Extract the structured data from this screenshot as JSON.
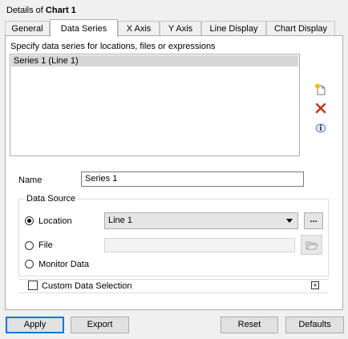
{
  "window": {
    "title_prefix": "Details of ",
    "title_subject": "Chart 1"
  },
  "tabs": [
    {
      "label": "General",
      "active": false
    },
    {
      "label": "Data Series",
      "active": true
    },
    {
      "label": "X Axis",
      "active": false
    },
    {
      "label": "Y Axis",
      "active": false
    },
    {
      "label": "Line Display",
      "active": false
    },
    {
      "label": "Chart Display",
      "active": false
    }
  ],
  "series_list": {
    "hint": "Specify data series for locations, files or expressions",
    "items": [
      "Series 1 (Line 1)"
    ],
    "selected_index": 0,
    "icons": [
      "new-series-icon",
      "delete-icon",
      "info-icon"
    ]
  },
  "name_field": {
    "label": "Name",
    "value": "Series 1"
  },
  "data_source": {
    "legend": "Data Source",
    "location_label": "Location",
    "location_value": "Line 1",
    "browse_dots": "...",
    "file_label": "File",
    "file_value": "",
    "monitor_label": "Monitor Data",
    "selected": "location"
  },
  "custom_selection": {
    "label": "Custom Data Selection",
    "checked": false,
    "expand_symbol": "+"
  },
  "buttons": {
    "apply": "Apply",
    "export": "Export",
    "reset": "Reset",
    "defaults": "Defaults"
  },
  "colors": {
    "accent": "#0078d7",
    "delete_red": "#c42b1c"
  }
}
